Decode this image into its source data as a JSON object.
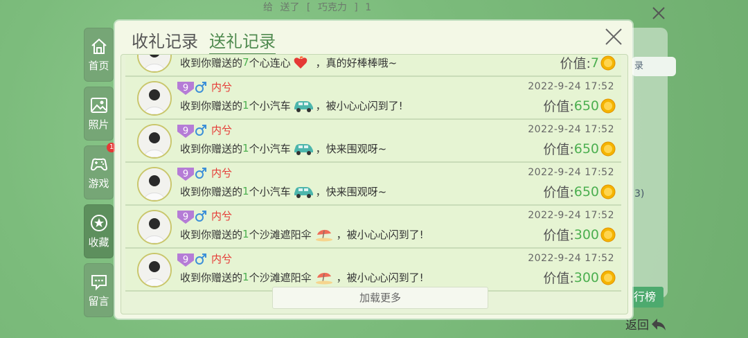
{
  "background": {
    "top_text": [
      "给",
      "送了",
      "[",
      "巧克力",
      "]",
      "1"
    ],
    "record_label": "录",
    "count_label": "3)",
    "rank_label": "行榜",
    "back_label": "返回"
  },
  "sidebar": {
    "items": [
      {
        "label": "首页",
        "icon": "home-icon"
      },
      {
        "label": "照片",
        "icon": "photo-icon"
      },
      {
        "label": "游戏",
        "icon": "gamepad-icon",
        "badge": "1"
      },
      {
        "label": "收藏",
        "icon": "star-icon"
      },
      {
        "label": "留言",
        "icon": "message-icon"
      }
    ]
  },
  "dialog": {
    "tabs": [
      {
        "label": "收礼记录",
        "active": false
      },
      {
        "label": "送礼记录",
        "active": true
      }
    ],
    "price_prefix": "价值:",
    "load_more": "加载更多",
    "records": [
      {
        "msg_prefix": "收到你赠送的",
        "count": "7",
        "unit": "个",
        "gift": "心连心",
        "gift_icon": "heart-gift-icon",
        "suffix": "，真的好棒棒哦~",
        "price": "7",
        "partial": true
      },
      {
        "level": "9",
        "name": "内兮",
        "msg_prefix": "收到你赠送的",
        "count": "1",
        "unit": "个",
        "gift": "小汽车",
        "gift_icon": "car-gift-icon",
        "suffix": "，被小心心闪到了!",
        "time": "2022-9-24 17:52",
        "price": "650"
      },
      {
        "level": "9",
        "name": "内兮",
        "msg_prefix": "收到你赠送的",
        "count": "1",
        "unit": "个",
        "gift": "小汽车",
        "gift_icon": "car-gift-icon",
        "suffix": "，快来围观呀~",
        "time": "2022-9-24 17:52",
        "price": "650"
      },
      {
        "level": "9",
        "name": "内兮",
        "msg_prefix": "收到你赠送的",
        "count": "1",
        "unit": "个",
        "gift": "小汽车",
        "gift_icon": "car-gift-icon",
        "suffix": "，快来围观呀~",
        "time": "2022-9-24 17:52",
        "price": "650"
      },
      {
        "level": "9",
        "name": "内兮",
        "msg_prefix": "收到你赠送的",
        "count": "1",
        "unit": "个",
        "gift": "沙滩遮阳伞",
        "gift_icon": "umbrella-gift-icon",
        "suffix": "，被小心心闪到了!",
        "time": "2022-9-24 17:52",
        "price": "300"
      },
      {
        "level": "9",
        "name": "内兮",
        "msg_prefix": "收到你赠送的",
        "count": "1",
        "unit": "个",
        "gift": "沙滩遮阳伞",
        "gift_icon": "umbrella-gift-icon",
        "suffix": "，被小心心闪到了!",
        "time": "2022-9-24 17:52",
        "price": "300"
      }
    ]
  }
}
